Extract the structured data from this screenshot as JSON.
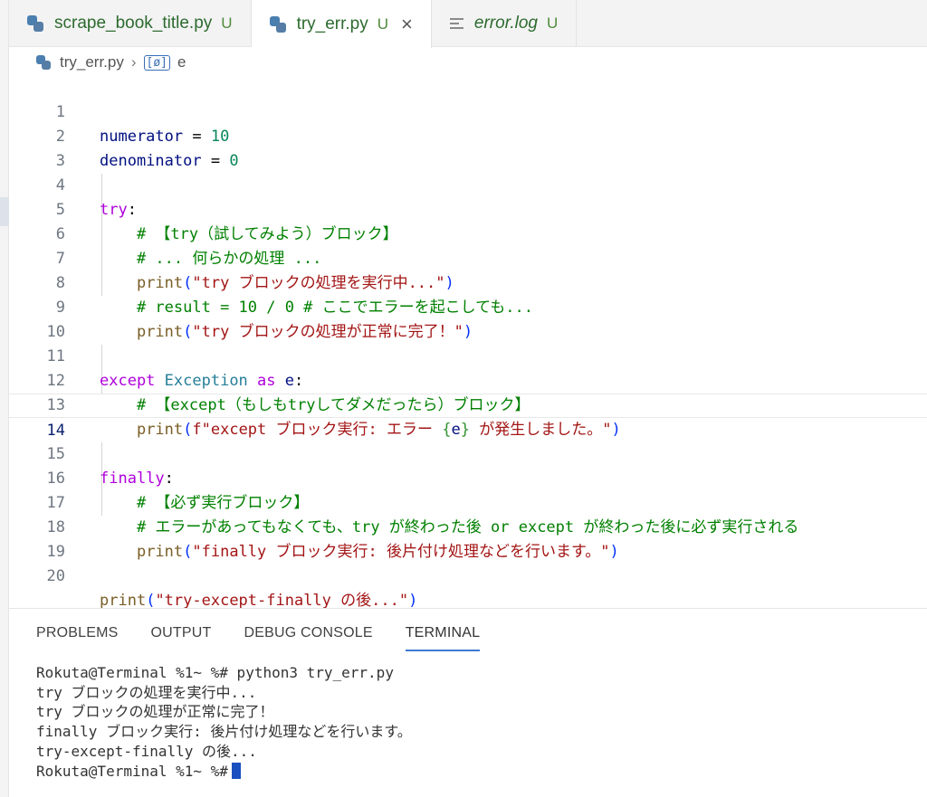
{
  "tabs": [
    {
      "name": "scrape_book_title.py",
      "badge": "U",
      "icon": "python-icon",
      "active": false
    },
    {
      "name": "try_err.py",
      "badge": "U",
      "icon": "python-icon",
      "active": true
    },
    {
      "name": "error.log",
      "badge": "U",
      "icon": "log-file-icon",
      "active": false
    }
  ],
  "breadcrumb": {
    "file": "try_err.py",
    "symbol": "e"
  },
  "editor": {
    "line_numbers": [
      "1",
      "2",
      "3",
      "4",
      "5",
      "6",
      "7",
      "8",
      "9",
      "10",
      "11",
      "12",
      "13",
      "14",
      "15",
      "16",
      "17",
      "18",
      "19",
      "20"
    ],
    "current_line": "14",
    "code": {
      "l1": {
        "var": "numerator",
        "op": " = ",
        "num": "10"
      },
      "l2": {
        "var": "denominator",
        "op": " = ",
        "num": "0"
      },
      "l4": {
        "kw": "try",
        "colon": ":"
      },
      "l5": {
        "comment": "# 【try（試してみよう）ブロック】"
      },
      "l6": {
        "comment": "# ... 何らかの処理 ..."
      },
      "l7": {
        "fn": "print",
        "open": "(",
        "str": "\"try ブロックの処理を実行中...\"",
        "close": ")"
      },
      "l8": {
        "comment": "# result = 10 / 0 # ここでエラーを起こしても..."
      },
      "l9": {
        "fn": "print",
        "open": "(",
        "str": "\"try ブロックの処理が正常に完了！\"",
        "close": ")"
      },
      "l11": {
        "kw": "except",
        "cls": "Exception",
        "kw2": "as",
        "var": "e",
        "colon": ":"
      },
      "l12": {
        "comment": "# 【except（もしもtryしてダメだったら）ブロック】"
      },
      "l13": {
        "fn": "print",
        "open": "(",
        "str1": "f\"except ブロック実行: エラー ",
        "lb": "{",
        "var": "e",
        "rb": "}",
        "str2": " が発生しました。\"",
        "close": ")"
      },
      "l15": {
        "kw": "finally",
        "colon": ":"
      },
      "l16": {
        "comment": "# 【必ず実行ブロック】"
      },
      "l17": {
        "comment": "# エラーがあってもなくても、try が終わった後 or except が終わった後に必ず実行される"
      },
      "l18": {
        "fn": "print",
        "open": "(",
        "str": "\"finally ブロック実行: 後片付け処理などを行います。\"",
        "close": ")"
      },
      "l20": {
        "fn": "print",
        "open": "(",
        "str": "\"try-except-finally の後...\"",
        "close": ")"
      }
    }
  },
  "panel": {
    "tabs": [
      "PROBLEMS",
      "OUTPUT",
      "DEBUG CONSOLE",
      "TERMINAL"
    ],
    "active_tab": "TERMINAL",
    "terminal_lines": [
      "Rokuta@Terminal %1~ %# python3 try_err.py",
      "try ブロックの処理を実行中...",
      "try ブロックの処理が正常に完了！",
      "finally ブロック実行: 後片付け処理などを行います。",
      "try-except-finally の後...",
      "Rokuta@Terminal %1~ %#"
    ]
  },
  "colors": {
    "keyword": "#af00db",
    "class": "#267f99",
    "function": "#795e26",
    "string": "#a31515",
    "number": "#098658",
    "comment": "#008000",
    "variable": "#001080",
    "accent": "#3b7bd1"
  }
}
